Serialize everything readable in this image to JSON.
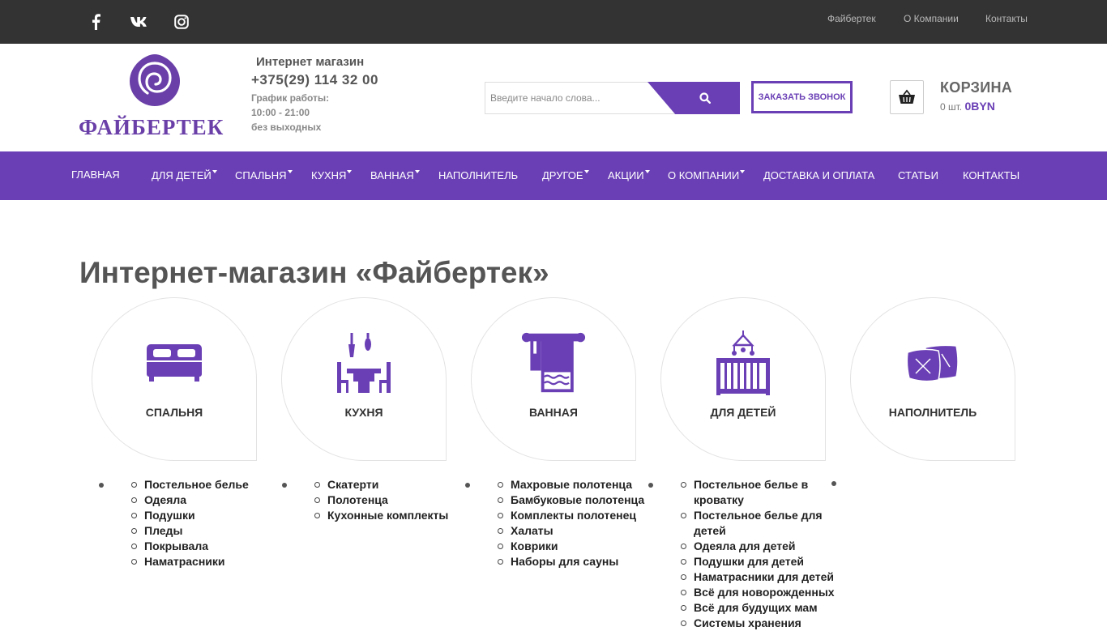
{
  "topbar": {
    "social": [
      "facebook-icon",
      "vk-icon",
      "instagram-icon"
    ],
    "links": [
      "Файбертек",
      "О Компании",
      "Контакты"
    ]
  },
  "header": {
    "logo_text": "ФАЙБЕРТЕК",
    "shop_title": "Интернет магазин",
    "phone": "+375(29) 114 32 00",
    "hours_label": "График работы:",
    "hours_time": "10:00 - 21:00",
    "hours_note": "без выходных",
    "search_placeholder": "Введите начало слова...",
    "callback_label": "ЗАКАЗАТЬ ЗВОНОК",
    "cart_title": "КОРЗИНА",
    "cart_count": "0 шт.",
    "cart_sum": "0BYN"
  },
  "nav": {
    "items": [
      "ГЛАВНАЯ",
      "ДЛЯ ДЕТЕЙ",
      "СПАЛЬНЯ",
      "КУХНЯ",
      "ВАННАЯ",
      "НАПОЛНИТЕЛЬ",
      "ДРУГОЕ",
      "АКЦИИ",
      "О КОМПАНИИ",
      "ДОСТАВКА И ОПЛАТА",
      "СТАТЬИ",
      "КОНТАКТЫ"
    ]
  },
  "main": {
    "title": "Интернет-магазин «Файбертек»",
    "categories": [
      {
        "label": "СПАЛЬНЯ",
        "icon": "bed-icon",
        "items": [
          "Постельное белье",
          "Одеяла",
          "Подушки",
          "Пледы",
          "Покрывала",
          "Наматрасники"
        ]
      },
      {
        "label": "КУХНЯ",
        "icon": "kitchen-table-icon",
        "items": [
          "Скатерти",
          "Полотенца",
          "Кухонные комплекты"
        ]
      },
      {
        "label": "ВАННАЯ",
        "icon": "towel-icon",
        "items": [
          "Махровые полотенца",
          "Бамбуковые полотенца",
          "Комплекты полотенец",
          "Халаты",
          "Коврики",
          "Наборы для сауны"
        ]
      },
      {
        "label": "ДЛЯ ДЕТЕЙ",
        "icon": "crib-icon",
        "items": [
          "Постельное белье в кроватку",
          "Постельное белье для детей",
          "Одеяла для детей",
          "Подушки для детей",
          "Наматрасники для детей",
          "Всё для новорожденных",
          "Всё для будущих мам",
          "Системы хранения"
        ]
      },
      {
        "label": "НАПОЛНИТЕЛЬ",
        "icon": "pillows-icon",
        "items": []
      }
    ]
  },
  "colors": {
    "accent": "#6a3fb5",
    "topbar": "#333333"
  }
}
